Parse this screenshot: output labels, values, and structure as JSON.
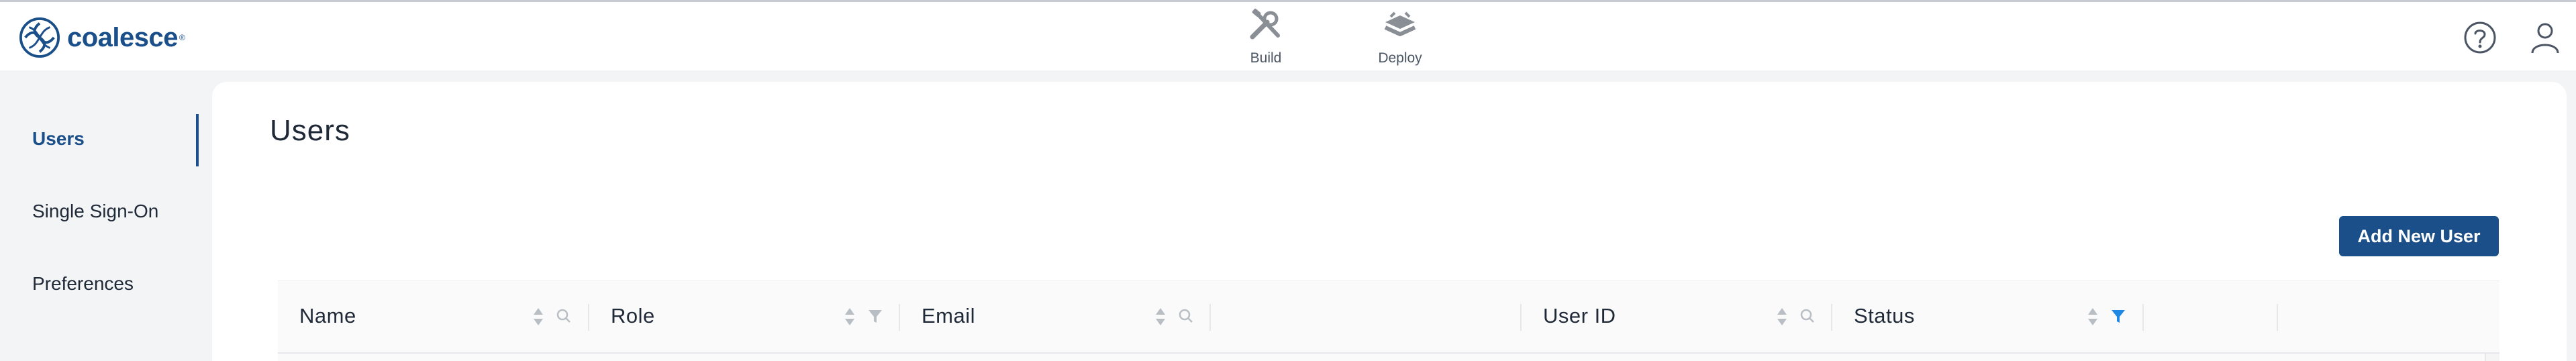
{
  "app": {
    "name": "coalesce",
    "trademark": "®"
  },
  "nav": {
    "tabs": [
      {
        "label": "Build",
        "icon": "build-tools-icon"
      },
      {
        "label": "Deploy",
        "icon": "deploy-icon"
      }
    ]
  },
  "topright": {
    "icons": [
      "help-icon",
      "user-icon"
    ]
  },
  "sidebar": {
    "items": [
      {
        "label": "Users",
        "active": true
      },
      {
        "label": "Single Sign-On",
        "active": false
      },
      {
        "label": "Preferences",
        "active": false
      }
    ]
  },
  "main": {
    "title": "Users",
    "add_button": "Add New User",
    "table": {
      "columns": [
        {
          "label": "Name",
          "sortable": true,
          "action": "search"
        },
        {
          "label": "Role",
          "sortable": true,
          "action": "filter"
        },
        {
          "label": "Email",
          "sortable": true,
          "action": "search"
        },
        {
          "label": "",
          "sortable": false,
          "action": ""
        },
        {
          "label": "User ID",
          "sortable": true,
          "action": "search"
        },
        {
          "label": "Status",
          "sortable": true,
          "action": "filter-active"
        },
        {
          "label": "",
          "sortable": false,
          "action": ""
        },
        {
          "label": "",
          "sortable": false,
          "action": ""
        }
      ]
    }
  },
  "colors": {
    "accent": "#1a4f8a",
    "filter_active": "#1e88e5",
    "background": "#f3f4f6"
  }
}
